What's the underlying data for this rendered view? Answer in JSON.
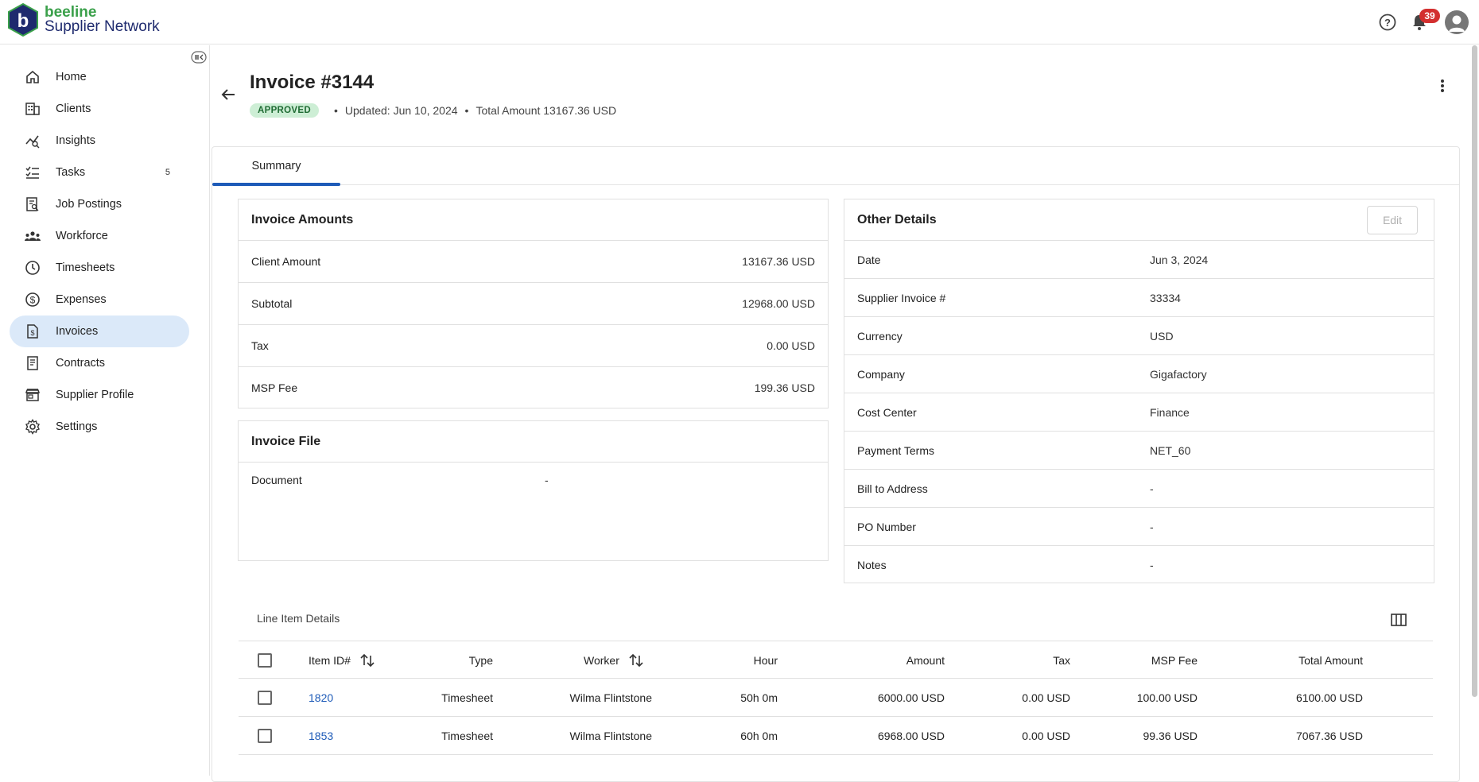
{
  "header": {
    "brand_small": "beeline",
    "brand_big": "Supplier Network",
    "notifications_count": "39"
  },
  "sidebar": {
    "items": [
      {
        "label": "Home",
        "icon": "home-icon"
      },
      {
        "label": "Clients",
        "icon": "building-icon"
      },
      {
        "label": "Insights",
        "icon": "insights-icon"
      },
      {
        "label": "Tasks",
        "icon": "tasks-icon",
        "count": "5"
      },
      {
        "label": "Job Postings",
        "icon": "job-postings-icon"
      },
      {
        "label": "Workforce",
        "icon": "workforce-icon"
      },
      {
        "label": "Timesheets",
        "icon": "clock-icon"
      },
      {
        "label": "Expenses",
        "icon": "dollar-icon"
      },
      {
        "label": "Invoices",
        "icon": "invoice-icon",
        "active": true
      },
      {
        "label": "Contracts",
        "icon": "contract-icon"
      },
      {
        "label": "Supplier Profile",
        "icon": "store-icon"
      },
      {
        "label": "Settings",
        "icon": "gear-icon"
      }
    ]
  },
  "page": {
    "title": "Invoice #3144",
    "status": "APPROVED",
    "updated": "Updated: Jun 10, 2024",
    "total": "Total Amount 13167.36 USD"
  },
  "tabs": [
    {
      "label": "Summary",
      "active": true
    }
  ],
  "invoice_amounts": {
    "title": "Invoice Amounts",
    "rows": [
      {
        "label": "Client Amount",
        "value": "13167.36 USD"
      },
      {
        "label": "Subtotal",
        "value": "12968.00 USD"
      },
      {
        "label": "Tax",
        "value": "0.00 USD"
      },
      {
        "label": "MSP Fee",
        "value": "199.36 USD"
      }
    ]
  },
  "invoice_file": {
    "title": "Invoice File",
    "document_label": "Document",
    "document_value": "-"
  },
  "other_details": {
    "title": "Other Details",
    "edit_label": "Edit",
    "rows": [
      {
        "label": "Date",
        "value": "Jun 3, 2024"
      },
      {
        "label": "Supplier Invoice #",
        "value": "33334"
      },
      {
        "label": "Currency",
        "value": "USD"
      },
      {
        "label": "Company",
        "value": "Gigafactory"
      },
      {
        "label": "Cost Center",
        "value": "Finance"
      },
      {
        "label": "Payment Terms",
        "value": "NET_60"
      },
      {
        "label": "Bill to Address",
        "value": "-"
      },
      {
        "label": "PO Number",
        "value": "-"
      },
      {
        "label": "Notes",
        "value": "-"
      }
    ]
  },
  "line_items": {
    "title": "Line Item Details",
    "columns": [
      "Item ID#",
      "Type",
      "Worker",
      "Hour",
      "Amount",
      "Tax",
      "MSP Fee",
      "Total Amount"
    ],
    "rows": [
      {
        "id": "1820",
        "type": "Timesheet",
        "worker": "Wilma Flintstone",
        "hour": "50h 0m",
        "amount": "6000.00 USD",
        "tax": "0.00 USD",
        "msp": "100.00 USD",
        "total": "6100.00 USD"
      },
      {
        "id": "1853",
        "type": "Timesheet",
        "worker": "Wilma Flintstone",
        "hour": "60h 0m",
        "amount": "6968.00 USD",
        "tax": "0.00 USD",
        "msp": "99.36 USD",
        "total": "7067.36 USD"
      }
    ]
  },
  "colors": {
    "accent": "#1e5bb8",
    "active_nav": "#dbe9f9",
    "approved_bg": "#cdeed5",
    "badge_red": "#d32f2f"
  }
}
